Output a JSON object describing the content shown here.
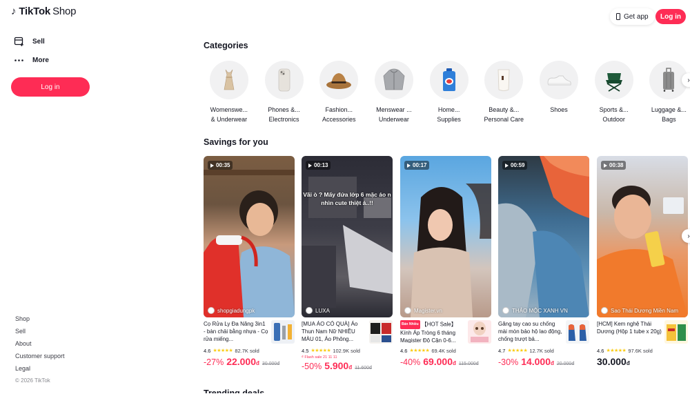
{
  "header": {
    "logo_note": "♪",
    "logo_tiktok": "TikTok",
    "logo_shop": "Shop",
    "get_app": "Get app",
    "login": "Log in"
  },
  "sidebar": {
    "items": [
      {
        "label": "Sell",
        "icon": "store-add-icon"
      },
      {
        "label": "More",
        "icon": "more-dots-icon"
      }
    ],
    "login": "Log in",
    "footer_links": [
      "Shop",
      "Sell",
      "About",
      "Customer support",
      "Legal"
    ],
    "copyright": "© 2026 TikTok"
  },
  "categories": {
    "title": "Categories",
    "items": [
      {
        "line1": "Womenswe...",
        "line2": "& Underwear",
        "icon": "dress-icon"
      },
      {
        "line1": "Phones &...",
        "line2": "Electronics",
        "icon": "phone-icon"
      },
      {
        "line1": "Fashion...",
        "line2": "Accessories",
        "icon": "hat-icon"
      },
      {
        "line1": "Menswear ...",
        "line2": "Underwear",
        "icon": "jacket-icon"
      },
      {
        "line1": "Home...",
        "line2": "Supplies",
        "icon": "detergent-bottle-icon"
      },
      {
        "line1": "Beauty &...",
        "line2": "Personal Care",
        "icon": "cosmetic-tube-icon"
      },
      {
        "line1": "Shoes",
        "line2": "",
        "icon": "sneaker-icon"
      },
      {
        "line1": "Sports &...",
        "line2": "Outdoor",
        "icon": "camping-chair-icon"
      },
      {
        "line1": "Luggage &...",
        "line2": "Bags",
        "icon": "suitcase-icon"
      }
    ]
  },
  "savings": {
    "title": "Savings for you",
    "cards": [
      {
        "duration": "00:35",
        "creator": "shopgiadungpk",
        "overlay": "",
        "tag": "",
        "title": "Cọ Rửa Ly Đa Năng 3in1 - bàn chải bằng nhựa - Cọ rửa miếng...",
        "rating": "4.6",
        "sold": "82.7K sold",
        "flash": "",
        "discount": "-27%",
        "price": "22.000",
        "currency": "đ",
        "original": "30.000đ",
        "colors": {
          "bg1": "#8a6a4a",
          "bg2": "#d98c6a",
          "accent": "#e0302a"
        }
      },
      {
        "duration": "00:13",
        "creator": "LUXA",
        "overlay": "Vãi ò ? Mấy đứa lớp 6 mặc áo n nhìn cute thiệt á..!!",
        "tag": "",
        "title": "[MUA ÁO CÓ QUÀ] Áo Thun Nam Nữ NHIỀU MÀU 01, Áo Phông...",
        "rating": "4.5",
        "sold": "102.9K sold",
        "flash": "₫ Flash sale 21 11 11",
        "discount": "-50%",
        "price": "5.900",
        "currency": "đ",
        "original": "11.600đ",
        "colors": {
          "bg1": "#2a2a33",
          "bg2": "#6d6a70",
          "accent": "#d8d8dc"
        }
      },
      {
        "duration": "00:17",
        "creator": "Magister.vn",
        "overlay": "",
        "tag": "Bán Nhiều",
        "title": "【HOT Sale】 Kính Áp Tròng 6 tháng Magister Độ Cận 0-6...",
        "rating": "4.6",
        "sold": "69.4K sold",
        "flash": "",
        "discount": "-40%",
        "price": "69.000",
        "currency": "đ",
        "original": "115.000đ",
        "colors": {
          "bg1": "#6fb6e8",
          "bg2": "#d8b8a8",
          "accent": "#2a1f1f"
        }
      },
      {
        "duration": "00:59",
        "creator": "THẢO MỘC XANH VN",
        "overlay": "",
        "tag": "",
        "title": "Găng tay cao su chống mài mòn bảo hộ lao động, chống trượt bả...",
        "rating": "4.7",
        "sold": "12.7K sold",
        "flash": "",
        "discount": "-30%",
        "price": "14.000",
        "currency": "đ",
        "original": "20.000đ",
        "colors": {
          "bg1": "#4a7fa6",
          "bg2": "#e86a3a",
          "accent": "#9fb3c2"
        }
      },
      {
        "duration": "00:38",
        "creator": "Sao Thái Dương Miền Nam",
        "overlay": "",
        "tag": "",
        "title": "[HCM] Kem nghệ Thái Dương (Hộp 1 tube x 20g)",
        "rating": "4.6",
        "sold": "97.6K sold",
        "flash": "",
        "discount": "",
        "price": "30.000",
        "currency": "đ",
        "original": "",
        "colors": {
          "bg1": "#e8a87c",
          "bg2": "#f07a2a",
          "accent": "#f5d04a"
        }
      }
    ]
  },
  "next_section_title": "Trending deals"
}
